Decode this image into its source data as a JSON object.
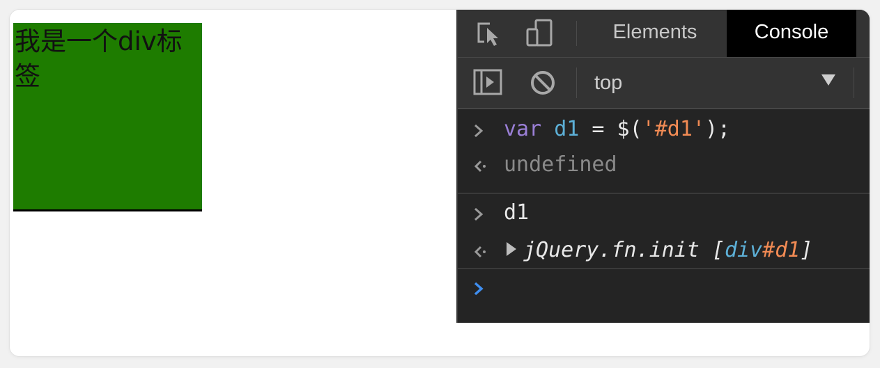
{
  "page": {
    "div_text": "我是一个div标签"
  },
  "devtools": {
    "tabs": [
      {
        "label": "Elements",
        "active": false
      },
      {
        "label": "Console",
        "active": true
      }
    ],
    "toolbar": {
      "context": "top"
    },
    "console": {
      "entries": [
        {
          "type": "input",
          "prompt": ">",
          "tokens": {
            "kw": "var",
            "name": " d1",
            "eq": " = $(",
            "str": "'#d1'",
            "end": ");"
          }
        },
        {
          "type": "output",
          "prompt": "<·",
          "text": "undefined"
        },
        {
          "type": "input",
          "prompt": ">",
          "text": "d1"
        },
        {
          "type": "output",
          "prompt": "<·",
          "obj": "jQuery.fn.init [",
          "tag": "div",
          "id": "#d1",
          "close": "]"
        }
      ],
      "prompt_symbol": ">"
    }
  },
  "colors": {
    "green_div": "#1e7c00",
    "devtools_bg": "#242424",
    "active_tab_bg": "#000000",
    "prompt_blue": "#3f8ef0"
  }
}
